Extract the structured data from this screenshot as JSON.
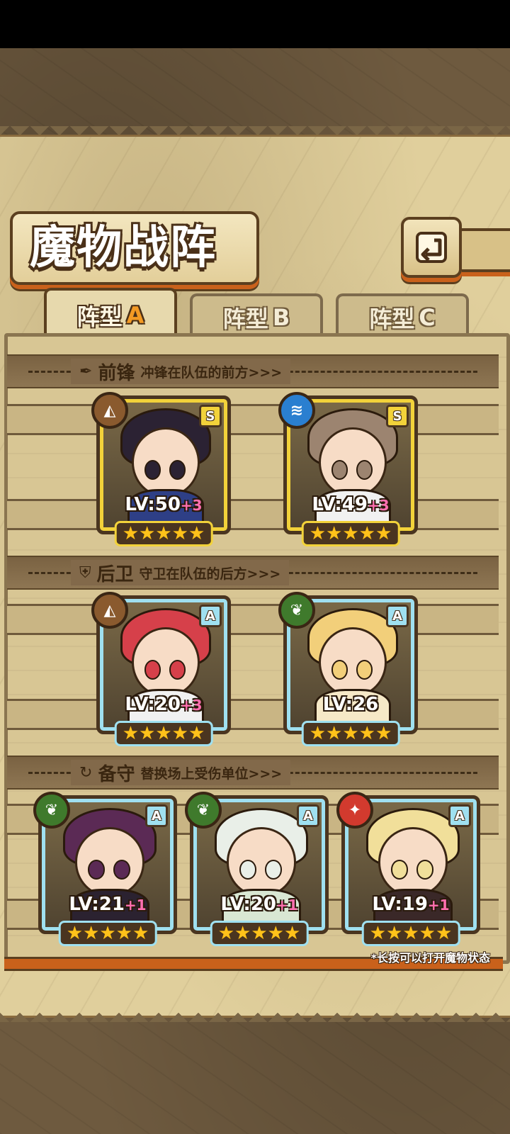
{
  "header": {
    "title": "魔物战阵",
    "back_icon": "back-arrow-icon"
  },
  "tabs": [
    {
      "label": "阵型",
      "letter": "A",
      "active": true
    },
    {
      "label": "阵型",
      "letter": "B",
      "active": false
    },
    {
      "label": "阵型",
      "letter": "C",
      "active": false
    }
  ],
  "sections": [
    {
      "icon": "sword-icon",
      "name": "前锋",
      "desc": "冲锋在队伍的前方>>>"
    },
    {
      "icon": "shield-icon",
      "name": "后卫",
      "desc": "守卫在队伍的后方>>>"
    },
    {
      "icon": "swap-icon",
      "name": "备守",
      "desc": "替换场上受伤单位>>>"
    }
  ],
  "monsters": {
    "front": [
      {
        "rank": "S",
        "element": "earth",
        "element_color": "#8a5a2e",
        "lv": "LV:50",
        "plus": "+3",
        "stars": "★★★★★",
        "hair_color": "#2b2233",
        "outfit_color": "#2e3f86"
      },
      {
        "rank": "S",
        "element": "water",
        "element_color": "#2a7fd0",
        "lv": "LV:49",
        "plus": "+3",
        "stars": "★★★★★",
        "hair_color": "#9c8470",
        "outfit_color": "#f1f1f1"
      }
    ],
    "back": [
      {
        "rank": "A",
        "element": "earth",
        "element_color": "#8a5a2e",
        "lv": "LV:20",
        "plus": "+3",
        "stars": "★★★★★",
        "hair_color": "#d6404a",
        "outfit_color": "#f1f1f1"
      },
      {
        "rank": "A",
        "element": "nature",
        "element_color": "#3f7a2c",
        "lv": "LV:26",
        "plus": "",
        "stars": "★★★★★",
        "hair_color": "#f2cf7a",
        "outfit_color": "#f6e9c7"
      }
    ],
    "reserve": [
      {
        "rank": "A",
        "element": "nature",
        "element_color": "#3f7a2c",
        "lv": "LV:21",
        "plus": "+1",
        "stars": "★★★★★",
        "hair_color": "#5b2a55",
        "outfit_color": "#2b2230"
      },
      {
        "rank": "A",
        "element": "nature",
        "element_color": "#3f7a2c",
        "lv": "LV:20",
        "plus": "+1",
        "stars": "★★★★★",
        "hair_color": "#e9efe8",
        "outfit_color": "#d9e7d3"
      },
      {
        "rank": "A",
        "element": "fire",
        "element_color": "#d23a2e",
        "lv": "LV:19",
        "plus": "+1",
        "stars": "★★★★★",
        "hair_color": "#f1df9a",
        "outfit_color": "#3a2828"
      }
    ]
  },
  "footer_note": "*长按可以打开魔物状态",
  "element_glyphs": {
    "earth": "◭",
    "water": "≋",
    "nature": "❦",
    "fire": "✦"
  }
}
